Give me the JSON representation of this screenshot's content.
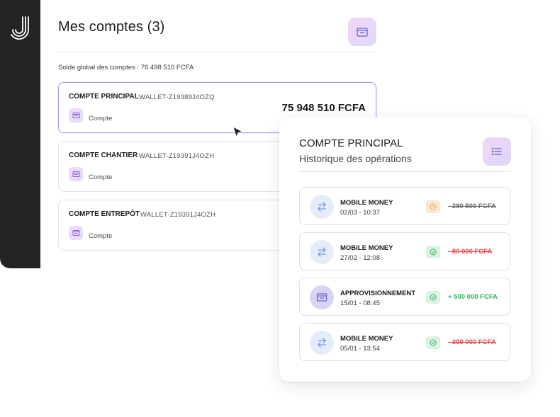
{
  "header": {
    "title": "Mes comptes (3)",
    "solde": "Solde global des comptes : 76 498 510 FCFA"
  },
  "accounts": [
    {
      "name": "COMPTE PRINCIPAL",
      "wallet": "WALLET-Z19389J4OZQ",
      "type": "Compte",
      "balance": "75 948 510 FCFA"
    },
    {
      "name": "COMPTE CHANTIER",
      "wallet": "WALLET-Z19391J4OZH",
      "type": "Compte",
      "balance": ""
    },
    {
      "name": "COMPTE ENTREPÔT",
      "wallet": "WALLET-Z19391J4OZH",
      "type": "Compte",
      "balance": ""
    }
  ],
  "history": {
    "title": "COMPTE PRINCIPAL",
    "subtitle": "Historique des opérations",
    "operations": [
      {
        "label": "MOBILE MONEY",
        "date": "02/03 - 10:37",
        "status": "pending",
        "amount": "- 280 500 FCFA",
        "icon": "transfer-arrows-icon"
      },
      {
        "label": "MOBILE MONEY",
        "date": "27/02 - 12:08",
        "status": "done",
        "amount": "- 80 000 FCFA",
        "icon": "transfer-arrows-icon"
      },
      {
        "label": "APPROVISIONNEMENT",
        "date": "15/01 - 08:45",
        "status": "done",
        "amount": "+ 500 000 FCFA",
        "icon": "wallet-icon"
      },
      {
        "label": "MOBILE MONEY",
        "date": "05/01 - 13:54",
        "status": "done",
        "amount": "- 300 000 FCFA",
        "icon": "transfer-arrows-icon"
      }
    ]
  },
  "colors": {
    "sidebar": "#242424",
    "accent": "#a89ae6",
    "negative": "#e5484d",
    "positive": "#2db45a",
    "pending": "#f2a15a"
  }
}
